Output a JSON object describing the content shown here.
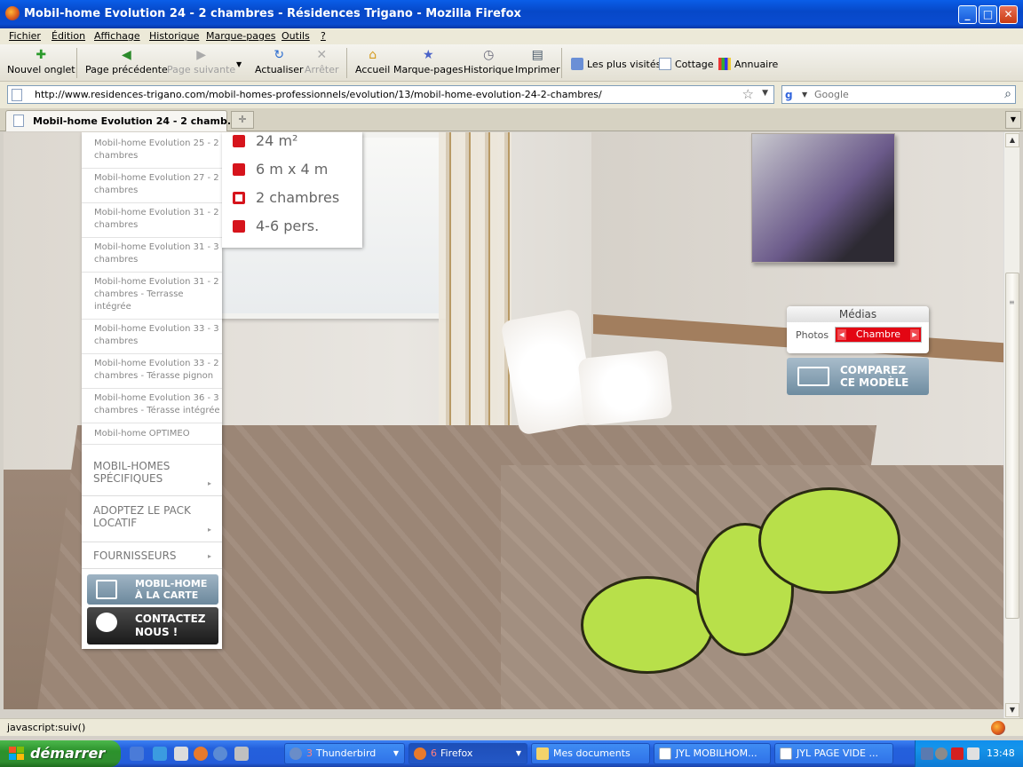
{
  "window": {
    "title": "Mobil-home Evolution 24 - 2 chambres - Résidences Trigano - Mozilla Firefox",
    "controls": [
      "_",
      "□",
      "✕"
    ]
  },
  "menubar": [
    "Fichier",
    "Édition",
    "Affichage",
    "Historique",
    "Marque-pages",
    "Outils",
    "?"
  ],
  "toolbar": {
    "new_tab": "Nouvel onglet",
    "back": "Page précédente",
    "forward": "Page suivante",
    "reload": "Actualiser",
    "stop": "Arrêter",
    "home": "Accueil",
    "bookmarks": "Marque-pages",
    "history": "Historique",
    "print": "Imprimer"
  },
  "bookmarks_bar": [
    "Les plus visités",
    "Cottage",
    "Annuaire"
  ],
  "address": {
    "url": "http://www.residences-trigano.com/mobil-homes-professionnels/evolution/13/mobil-home-evolution-24-2-chambres/",
    "search_placeholder": "Google"
  },
  "tabs": [
    {
      "label": "Mobil-home Evolution 24 - 2 chamb...",
      "active": true
    }
  ],
  "left_menu": {
    "items": [
      [
        "Mobil-home Evolution 25 - 2",
        "chambres"
      ],
      [
        "Mobil-home Evolution 27 - 2",
        "chambres"
      ],
      [
        "Mobil-home Evolution 31 - 2",
        "chambres"
      ],
      [
        "Mobil-home Evolution 31 - 3",
        "chambres"
      ],
      [
        "Mobil-home Evolution 31 - 2",
        "chambres - Terrasse",
        "intégrée"
      ],
      [
        "Mobil-home Evolution 33 - 3",
        "chambres"
      ],
      [
        "Mobil-home Evolution 33 - 2",
        "chambres - Térasse pignon"
      ],
      [
        "Mobil-home Evolution 36 - 3",
        "chambres - Térasse intégrée"
      ],
      [
        "Mobil-home OPTIMEO"
      ]
    ],
    "sections": [
      [
        "MOBIL-HOMES",
        "SPÉCIFIQUES"
      ],
      [
        "ADOPTEZ LE PACK",
        "LOCATIF"
      ],
      [
        "FOURNISSEURS"
      ]
    ],
    "buttons": {
      "carte": [
        "MOBIL-HOME",
        "À LA CARTE"
      ],
      "contact": [
        "CONTACTEZ",
        "NOUS !"
      ]
    }
  },
  "features": [
    {
      "icon": "surface-icon",
      "label": "24 m²"
    },
    {
      "icon": "dimensions-icon",
      "label": "6 m x 4 m"
    },
    {
      "icon": "bedroom-icon",
      "label": "2 chambres"
    },
    {
      "icon": "persons-icon",
      "label": "4-6 pers."
    }
  ],
  "medias": {
    "title": "Médias",
    "photos_label": "Photos",
    "selected": "Chambre"
  },
  "compare": [
    "COMPAREZ",
    "CE MODÈLE"
  ],
  "status": "javascript:suiv()",
  "taskbar": {
    "start": "démarrer",
    "tasks": [
      {
        "count": "3",
        "label": "Thunderbird"
      },
      {
        "count": "6",
        "label": "Firefox"
      },
      {
        "count": "",
        "label": "Mes documents"
      },
      {
        "count": "",
        "label": "JYL   MOBILHOM..."
      },
      {
        "count": "",
        "label": "JYL   PAGE VIDE ..."
      }
    ],
    "clock": "13:48"
  },
  "colors": {
    "accent_red": "#e30613",
    "xp_blue": "#245ddb",
    "start_green": "#2f8e2f"
  }
}
